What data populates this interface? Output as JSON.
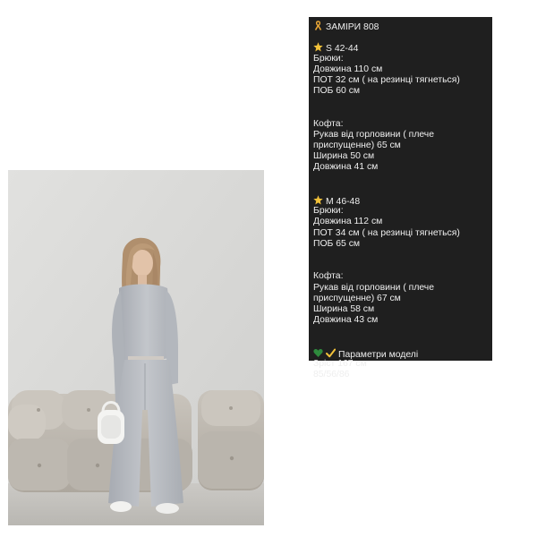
{
  "panel": {
    "colors": {
      "background": "#1f1f1f",
      "text": "#eeeeee",
      "ribbon": "#e8a636",
      "star": "#f3c23a",
      "heart": "#2e8b3d",
      "check": "#f3c23a"
    },
    "header": {
      "icon": "ribbon-icon",
      "text": "ЗАМІРИ 808"
    },
    "size_s": {
      "icon": "star-icon",
      "title": "S 42-44",
      "pants_label": "Брюки:",
      "pants_lines": [
        "Довжина 110 см",
        "ПОТ 32 см ( на резинці тягнеться)",
        "ПОБ 60 см"
      ],
      "top_label": "Кофта:",
      "top_lines": [
        "Рукав  від горловини ( плече",
        "приспущенне) 65 см",
        "Ширина 50 см",
        "Довжина 41 см"
      ]
    },
    "size_m": {
      "icon": "star-icon",
      "title": "M 46-48",
      "pants_label": "Брюки:",
      "pants_lines": [
        "Довжина 112 см",
        "ПОТ 34 см ( на резинці тягнеться)",
        "ПОБ 65 см"
      ],
      "top_label": "Кофта:",
      "top_lines": [
        "Рукав від горловини ( плече",
        "приспущенне) 67 см",
        "Ширина 58 см",
        "Довжина 43 см"
      ]
    },
    "model": {
      "icons": [
        "green-heart-icon",
        "check-icon"
      ],
      "title": "Параметри моделі",
      "lines": [
        "Зріст 167 см",
        "85/56/86"
      ]
    }
  },
  "photo": {
    "subject": "woman-in-grey-sweatsuit",
    "colors": {
      "wall": "#d9d9d7",
      "floor": "#c7c5c1",
      "sofa": "#bfbab2",
      "outfit": "#b9bcc2",
      "hair": "#b49473",
      "skin": "#e1c2a8",
      "bag": "#f4f4f2"
    }
  }
}
